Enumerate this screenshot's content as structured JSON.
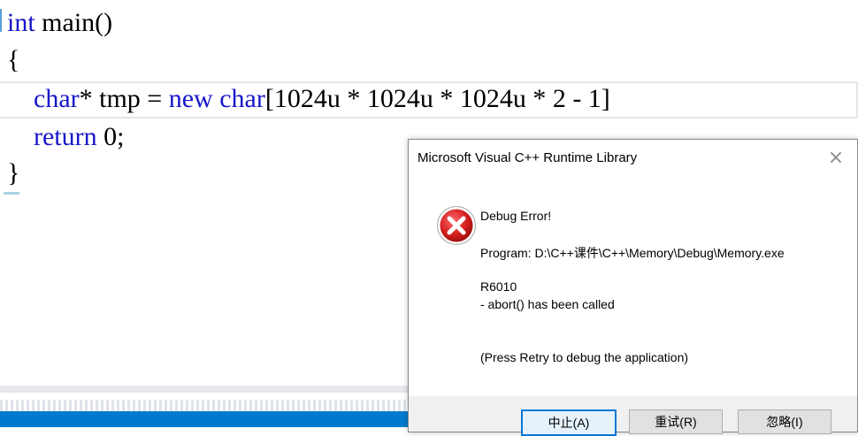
{
  "editor": {
    "lines": [
      {
        "kw": "int",
        "rest": " main()"
      },
      {
        "text": "{"
      },
      {
        "indent": "    ",
        "kw1": "char",
        "mid": "* tmp = ",
        "kw2": "new",
        "sp": " ",
        "kw3": "char",
        "rest": "[1024u * 1024u * 1024u * 2 - 1]"
      },
      {
        "indent": "    ",
        "kw": "return",
        "rest": " 0;"
      },
      {
        "text": "}"
      }
    ],
    "colors": {
      "keyword": "#1717c9",
      "text": "#000000",
      "status_bar": "#007acc"
    }
  },
  "dialog": {
    "title": "Microsoft Visual C++ Runtime Library",
    "close_glyph": "×",
    "icon": "error-icon",
    "messages": {
      "heading": "Debug Error!",
      "program": "Program: D:\\C++课件\\C++\\Memory\\Debug\\Memory.exe",
      "code": "R6010",
      "detail": "- abort() has been called",
      "hint": "(Press Retry to debug the application)"
    },
    "buttons": {
      "abort": "中止(A)",
      "retry": "重试(R)",
      "ignore": "忽略(I)"
    }
  }
}
